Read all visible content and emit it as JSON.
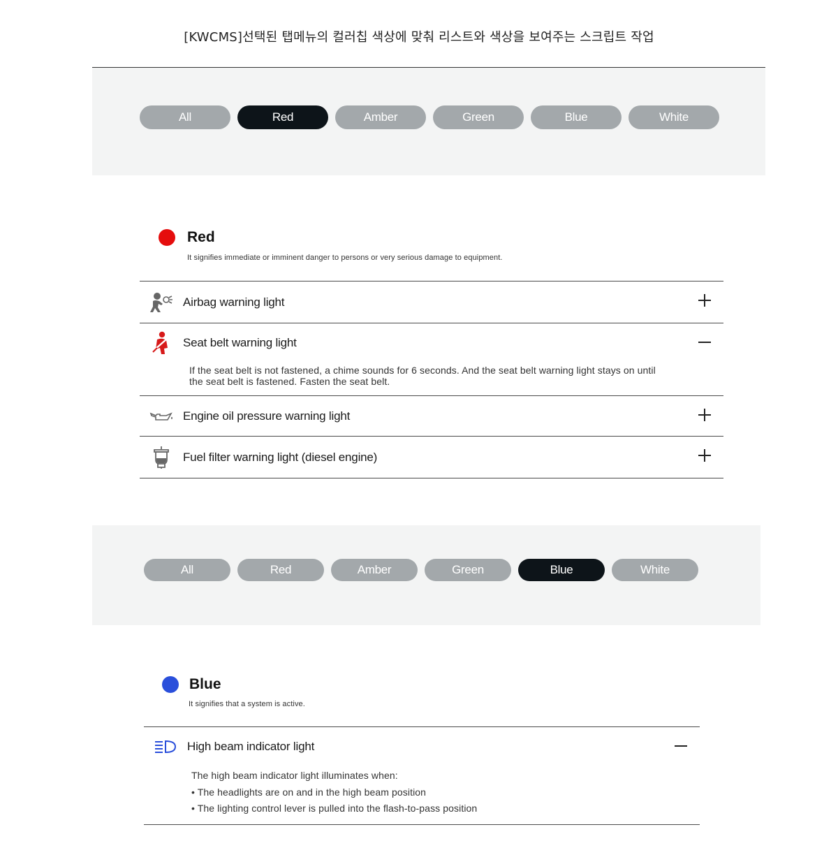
{
  "page": {
    "title": "[KWCMS]선택된 탭메뉴의 컬러칩 색상에 맞춰 리스트와 색상을 보여주는 스크립트 작업"
  },
  "tabs_top": {
    "items": [
      "All",
      "Red",
      "Amber",
      "Green",
      "Blue",
      "White"
    ],
    "active": "Red"
  },
  "red_section": {
    "name": "Red",
    "color": "#e50d0d",
    "description": "It signifies immediate or imminent danger to persons or very serious damage to equipment.",
    "items": [
      {
        "title": "Airbag warning light",
        "icon": "airbag-icon",
        "expanded": false
      },
      {
        "title": "Seat belt warning light",
        "icon": "seatbelt-icon",
        "expanded": true,
        "body": "If the seat belt is not fastened, a chime sounds for 6 seconds. And the seat belt warning light stays on until the seat belt is fastened. Fasten the seat belt."
      },
      {
        "title": "Engine oil pressure warning light",
        "icon": "oil-can-icon",
        "expanded": false
      },
      {
        "title": "Fuel filter warning light (diesel engine)",
        "icon": "fuel-filter-icon",
        "expanded": false
      }
    ]
  },
  "tabs_bottom": {
    "items": [
      "All",
      "Red",
      "Amber",
      "Green",
      "Blue",
      "White"
    ],
    "active": "Blue"
  },
  "blue_section": {
    "name": "Blue",
    "color": "#2a4fdb",
    "description": "It signifies that a system is active.",
    "items": [
      {
        "title": "High beam indicator light",
        "icon": "high-beam-icon",
        "expanded": true,
        "body_intro": "The high beam indicator light illuminates when:",
        "body_bullets": [
          "• The headlights are on and in the high beam position",
          "• The lighting control lever is pulled into the flash-to-pass position"
        ]
      }
    ]
  },
  "colors": {
    "tab_inactive": "#a3a8ab",
    "tab_active": "#0d1419",
    "band_bg": "#f3f4f4"
  }
}
